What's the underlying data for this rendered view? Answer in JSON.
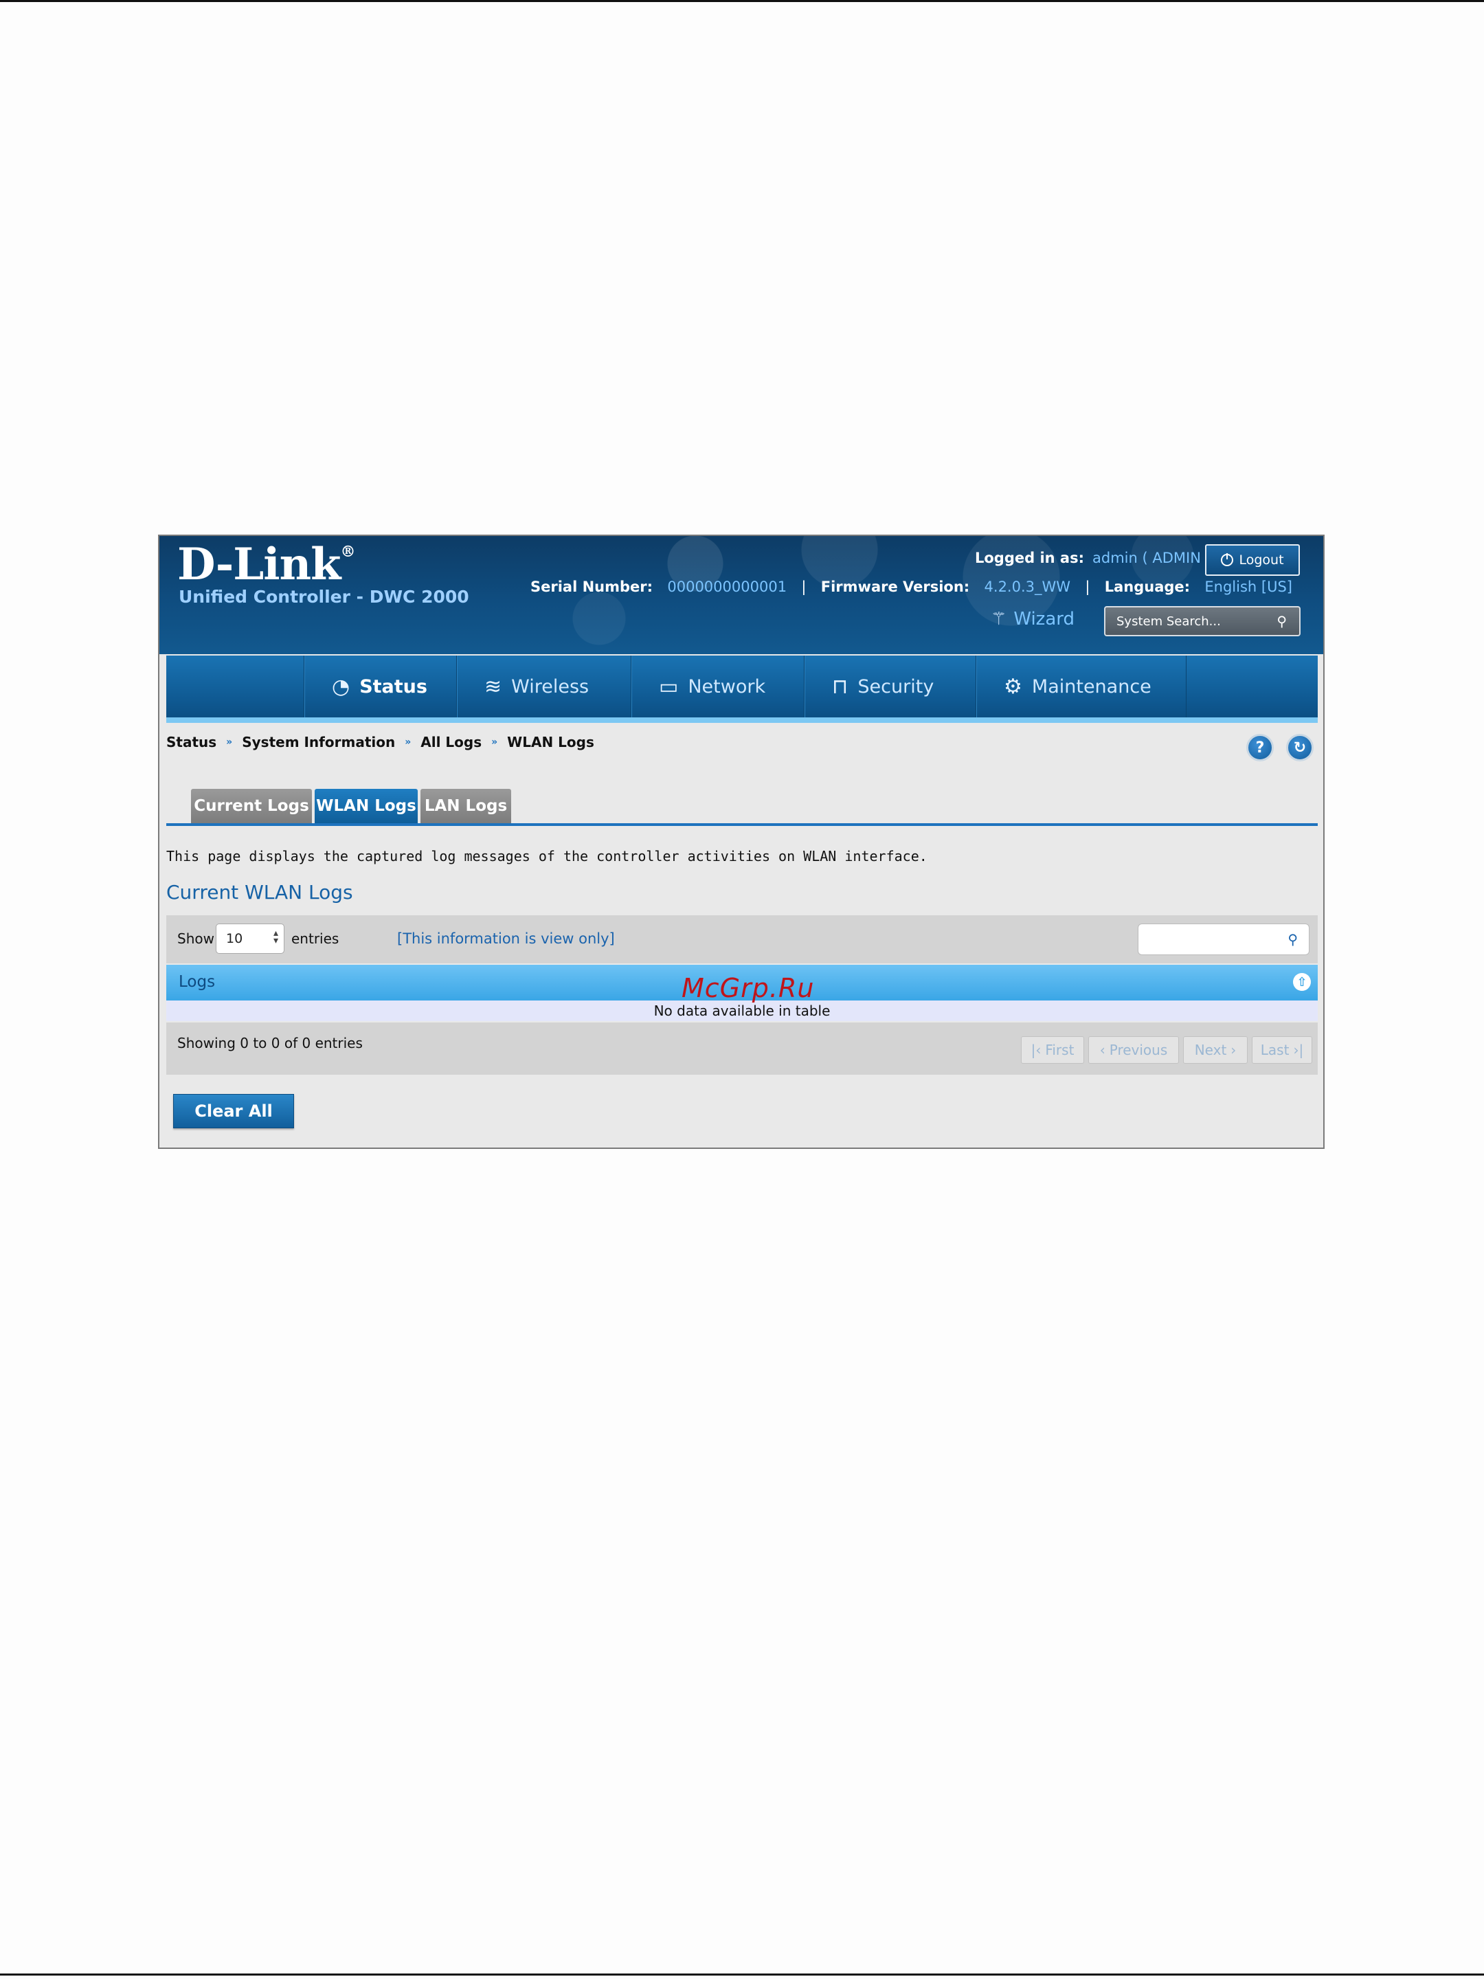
{
  "header": {
    "brand": "D-Link",
    "brand_mark": "®",
    "product": "Unified Controller - DWC 2000",
    "logged_in_label": "Logged in as:",
    "logged_in_value": "admin ( ADMIN )",
    "logout_label": "Logout",
    "serial_label": "Serial Number:",
    "serial_value": "0000000000001",
    "firmware_label": "Firmware Version:",
    "firmware_value": "4.2.0.3_WW",
    "language_label": "Language:",
    "language_value": "English [US]",
    "wizard_label": "Wizard",
    "search_placeholder": "System Search..."
  },
  "nav": {
    "items": [
      {
        "label": "Status",
        "icon": "speedometer-icon"
      },
      {
        "label": "Wireless",
        "icon": "wifi-icon"
      },
      {
        "label": "Network",
        "icon": "computer-icon"
      },
      {
        "label": "Security",
        "icon": "lock-icon"
      },
      {
        "label": "Maintenance",
        "icon": "gears-icon"
      }
    ],
    "active": "Status"
  },
  "breadcrumb": [
    "Status",
    "System Information",
    "All Logs",
    "WLAN Logs"
  ],
  "tabs": [
    {
      "label": "Current Logs",
      "active": false
    },
    {
      "label": "WLAN Logs",
      "active": true
    },
    {
      "label": "LAN Logs",
      "active": false
    }
  ],
  "page": {
    "description": "This page displays the captured log messages of the controller activities on WLAN interface.",
    "section_title": "Current WLAN Logs"
  },
  "table": {
    "show_label": "Show",
    "show_value": "10",
    "entries_label": "entries",
    "view_only_text": "[This information is view only]",
    "column_header": "Logs",
    "empty_text": "No data available in table",
    "showing_text": "Showing 0 to 0 of 0 entries",
    "pagination": [
      "First",
      "Previous",
      "Next",
      "Last"
    ]
  },
  "actions": {
    "clear_all": "Clear All"
  },
  "watermark": "McGrp.Ru",
  "colors": {
    "header_blue": "#0f4d80",
    "accent_blue": "#1e73be",
    "logs_header": "#3aa6e6"
  }
}
